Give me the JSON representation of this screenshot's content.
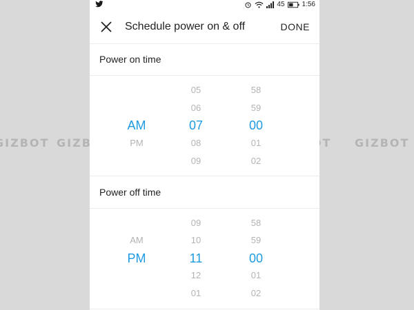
{
  "status_bar": {
    "battery_level": "45",
    "time": "1:56",
    "icons": [
      "twitter-icon",
      "alarm-icon",
      "wifi-icon",
      "signal-icon",
      "battery-icon"
    ]
  },
  "header": {
    "close_icon": "close-icon",
    "title": "Schedule power on & off",
    "done_label": "DONE"
  },
  "power_on": {
    "label": "Power on time",
    "ampm": [
      "AM",
      "PM"
    ],
    "ampm_selected": "AM",
    "hours": [
      "05",
      "06",
      "07",
      "08",
      "09"
    ],
    "hour_selected": "07",
    "minutes": [
      "58",
      "59",
      "00",
      "01",
      "02"
    ],
    "minute_selected": "00"
  },
  "power_off": {
    "label": "Power off time",
    "ampm": [
      "AM",
      "PM"
    ],
    "ampm_selected": "PM",
    "hours": [
      "09",
      "10",
      "11",
      "12",
      "01"
    ],
    "hour_selected": "11",
    "minutes": [
      "58",
      "59",
      "00",
      "01",
      "02"
    ],
    "minute_selected": "00"
  },
  "watermark": "GIZBOT",
  "colors": {
    "accent": "#1e9be0",
    "muted_text": "#b3b3b3",
    "page_background": "#d9d9d9"
  }
}
